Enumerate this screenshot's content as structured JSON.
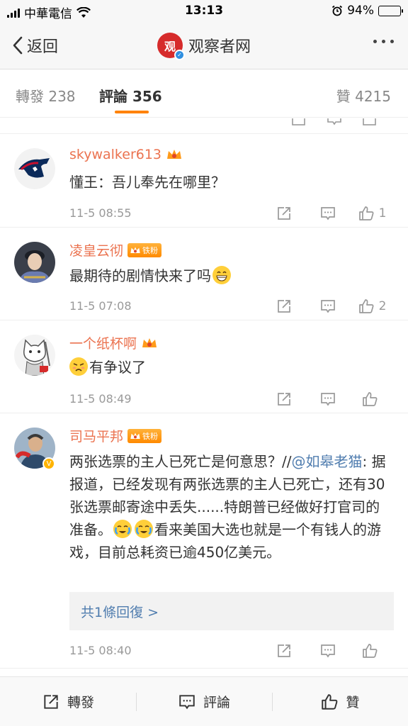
{
  "status_bar": {
    "carrier": "中華電信",
    "time": "13:13",
    "battery": "94%",
    "battery_level": 0.94
  },
  "nav": {
    "back_label": "返回",
    "title": "观察者网",
    "logo_text": "观"
  },
  "tabs": {
    "repost": "轉發 238",
    "comment": "評論 356",
    "like": "贊 4215"
  },
  "comments": [
    {
      "username": "skywalker613",
      "badges": [
        "crown"
      ],
      "text": "懂王：吾儿奉先在哪里？",
      "time": "11-5 08:55",
      "likes": "1"
    },
    {
      "username": "凌皇云彻",
      "badges": [
        "crown",
        "铁粉"
      ],
      "text": "最期待的剧情快来了吗",
      "emoji_suffix": "grin",
      "time": "11-5 07:08",
      "likes": "2"
    },
    {
      "username": "一个纸杯啊",
      "badges": [
        "crown"
      ],
      "emoji_prefix": "pout",
      "text": "有争议了",
      "time": "11-5 08:49",
      "likes": ""
    },
    {
      "username": "司马平邦",
      "badges": [
        "crown",
        "铁粉"
      ],
      "text_part1": "两张选票的主人已死亡是何意思？//",
      "mention": "@如皋老猫",
      "text_part2": ": 据报道，已经发现有两张选票的主人已死亡，还有30张选票邮寄途中丢失......特朗普已经做好打官司的准备。",
      "text_part3": "看来美国大选也就是一个有钱人的游戏，目前总耗资已逾450亿美元。",
      "reply_link": "共1條回復 >",
      "time": "11-5 08:40",
      "likes": ""
    }
  ],
  "fan_badge_text": "铁粉",
  "bottom_bar": {
    "repost": "轉發",
    "comment": "評論",
    "like": "贊"
  },
  "colors": {
    "accent": "#ff8200",
    "username": "#eb7350",
    "link": "#507daf",
    "logo": "#d62b2b"
  }
}
